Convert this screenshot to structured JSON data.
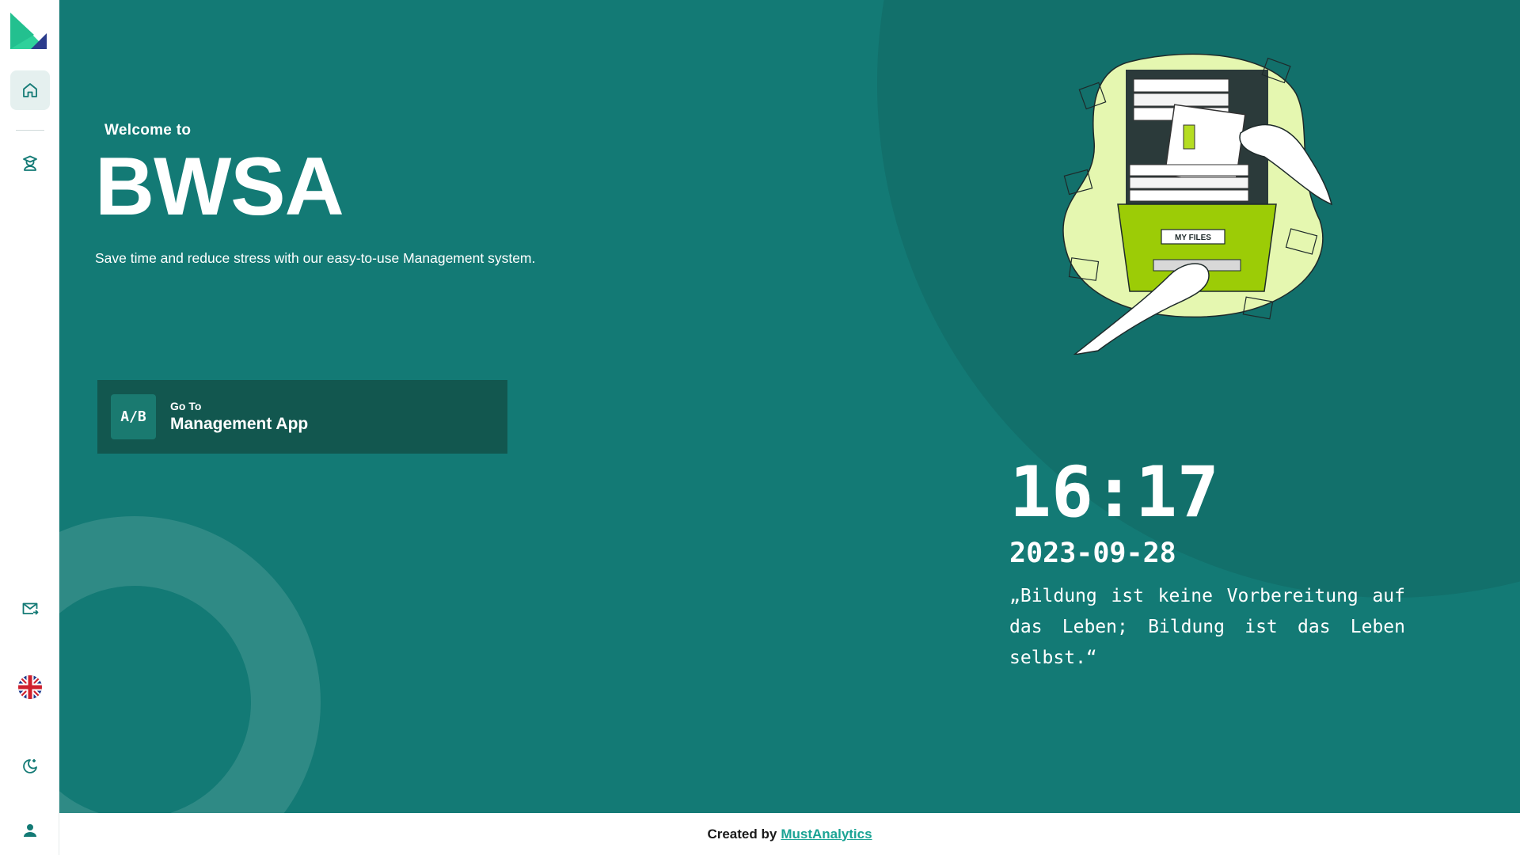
{
  "sidebar": {
    "items": [
      {
        "name": "home",
        "icon": "home-icon"
      },
      {
        "name": "teacher",
        "icon": "teacher-icon"
      },
      {
        "name": "mail",
        "icon": "mail-icon"
      },
      {
        "name": "language",
        "icon": "uk-flag-icon"
      },
      {
        "name": "theme",
        "icon": "moon-stars-icon"
      },
      {
        "name": "profile",
        "icon": "user-icon"
      }
    ]
  },
  "hero": {
    "welcome": "Welcome to",
    "title": "BWSA",
    "subtitle": "Save time and reduce stress with our easy-to-use Management system."
  },
  "goto": {
    "small": "Go To",
    "label": "Management App",
    "icon_text": "A/B"
  },
  "illustration": {
    "label": "MY FILES"
  },
  "clock": {
    "time": "16:17",
    "date": "2023-09-28"
  },
  "quote": "„Bildung ist keine Vorbereitung auf das Leben; Bildung ist das Leben selbst.“",
  "footer": {
    "created_by": "Created by",
    "link": "MustAnalytics"
  },
  "colors": {
    "main_bg": "#137a75",
    "accent": "#1aa394",
    "button_bg": "#12574f"
  }
}
